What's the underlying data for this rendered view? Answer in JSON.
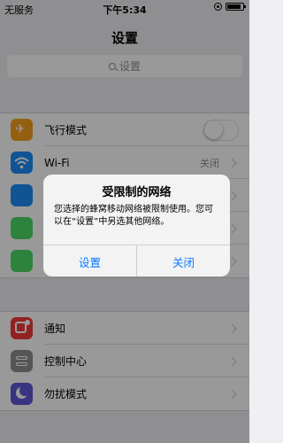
{
  "status_bar": {
    "carrier": "无服务",
    "time": "下午5:34"
  },
  "nav": {
    "title": "设置"
  },
  "search": {
    "placeholder": "设置"
  },
  "group1": [
    {
      "label": "飞行模式",
      "icon": "airplane-icon",
      "icon_color": "#f7a11b",
      "control": "toggle",
      "on": false
    },
    {
      "label": "Wi-Fi",
      "value": "关闭",
      "icon": "wifi-icon",
      "icon_color": "#1c8df5",
      "control": "chevron"
    },
    {
      "label": "",
      "icon": "bluetooth-icon",
      "icon_color": "#1c8df5",
      "control": "chevron"
    },
    {
      "label": "",
      "icon": "cellular-icon",
      "icon_color": "#4cd964",
      "control": "chevron"
    },
    {
      "label": "",
      "icon": "hotspot-icon",
      "icon_color": "#4cd964",
      "control": "chevron"
    }
  ],
  "group2": [
    {
      "label": "通知",
      "icon": "notifications-icon",
      "icon_color": "#f23a3a",
      "control": "chevron"
    },
    {
      "label": "控制中心",
      "icon": "control-center-icon",
      "icon_color": "#8e8e93",
      "control": "chevron"
    },
    {
      "label": "勿扰模式",
      "icon": "do-not-disturb-icon",
      "icon_color": "#5f58d6",
      "control": "chevron"
    }
  ],
  "alert": {
    "title": "受限制的网络",
    "message": "您选择的蜂窝移动网络被限制使用。您可以在“设置”中另选其他网络。",
    "buttons": {
      "left": "设置",
      "right": "关闭"
    },
    "button_color": "#0a7aff"
  }
}
